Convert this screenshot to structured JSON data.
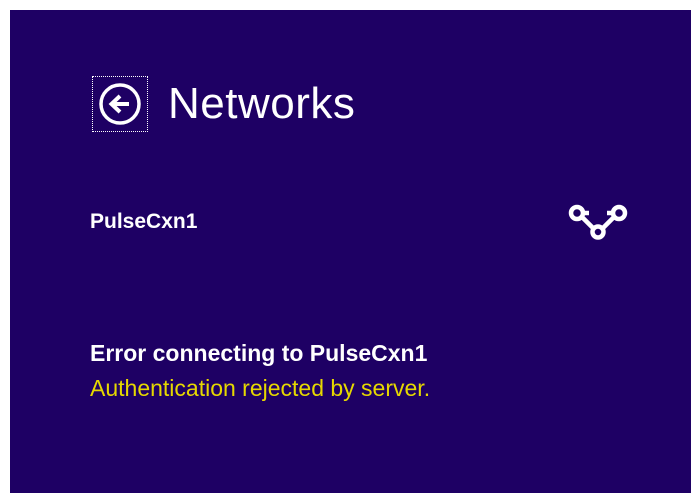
{
  "header": {
    "title": "Networks",
    "back_icon": "back-arrow-circle-icon"
  },
  "network": {
    "name": "PulseCxn1",
    "icon": "vpn-link-icon"
  },
  "error": {
    "title": "Error connecting to PulseCxn1",
    "detail": "Authentication rejected by server."
  },
  "colors": {
    "background": "#1e0064",
    "text": "#ffffff",
    "error_detail": "#e6d800"
  }
}
